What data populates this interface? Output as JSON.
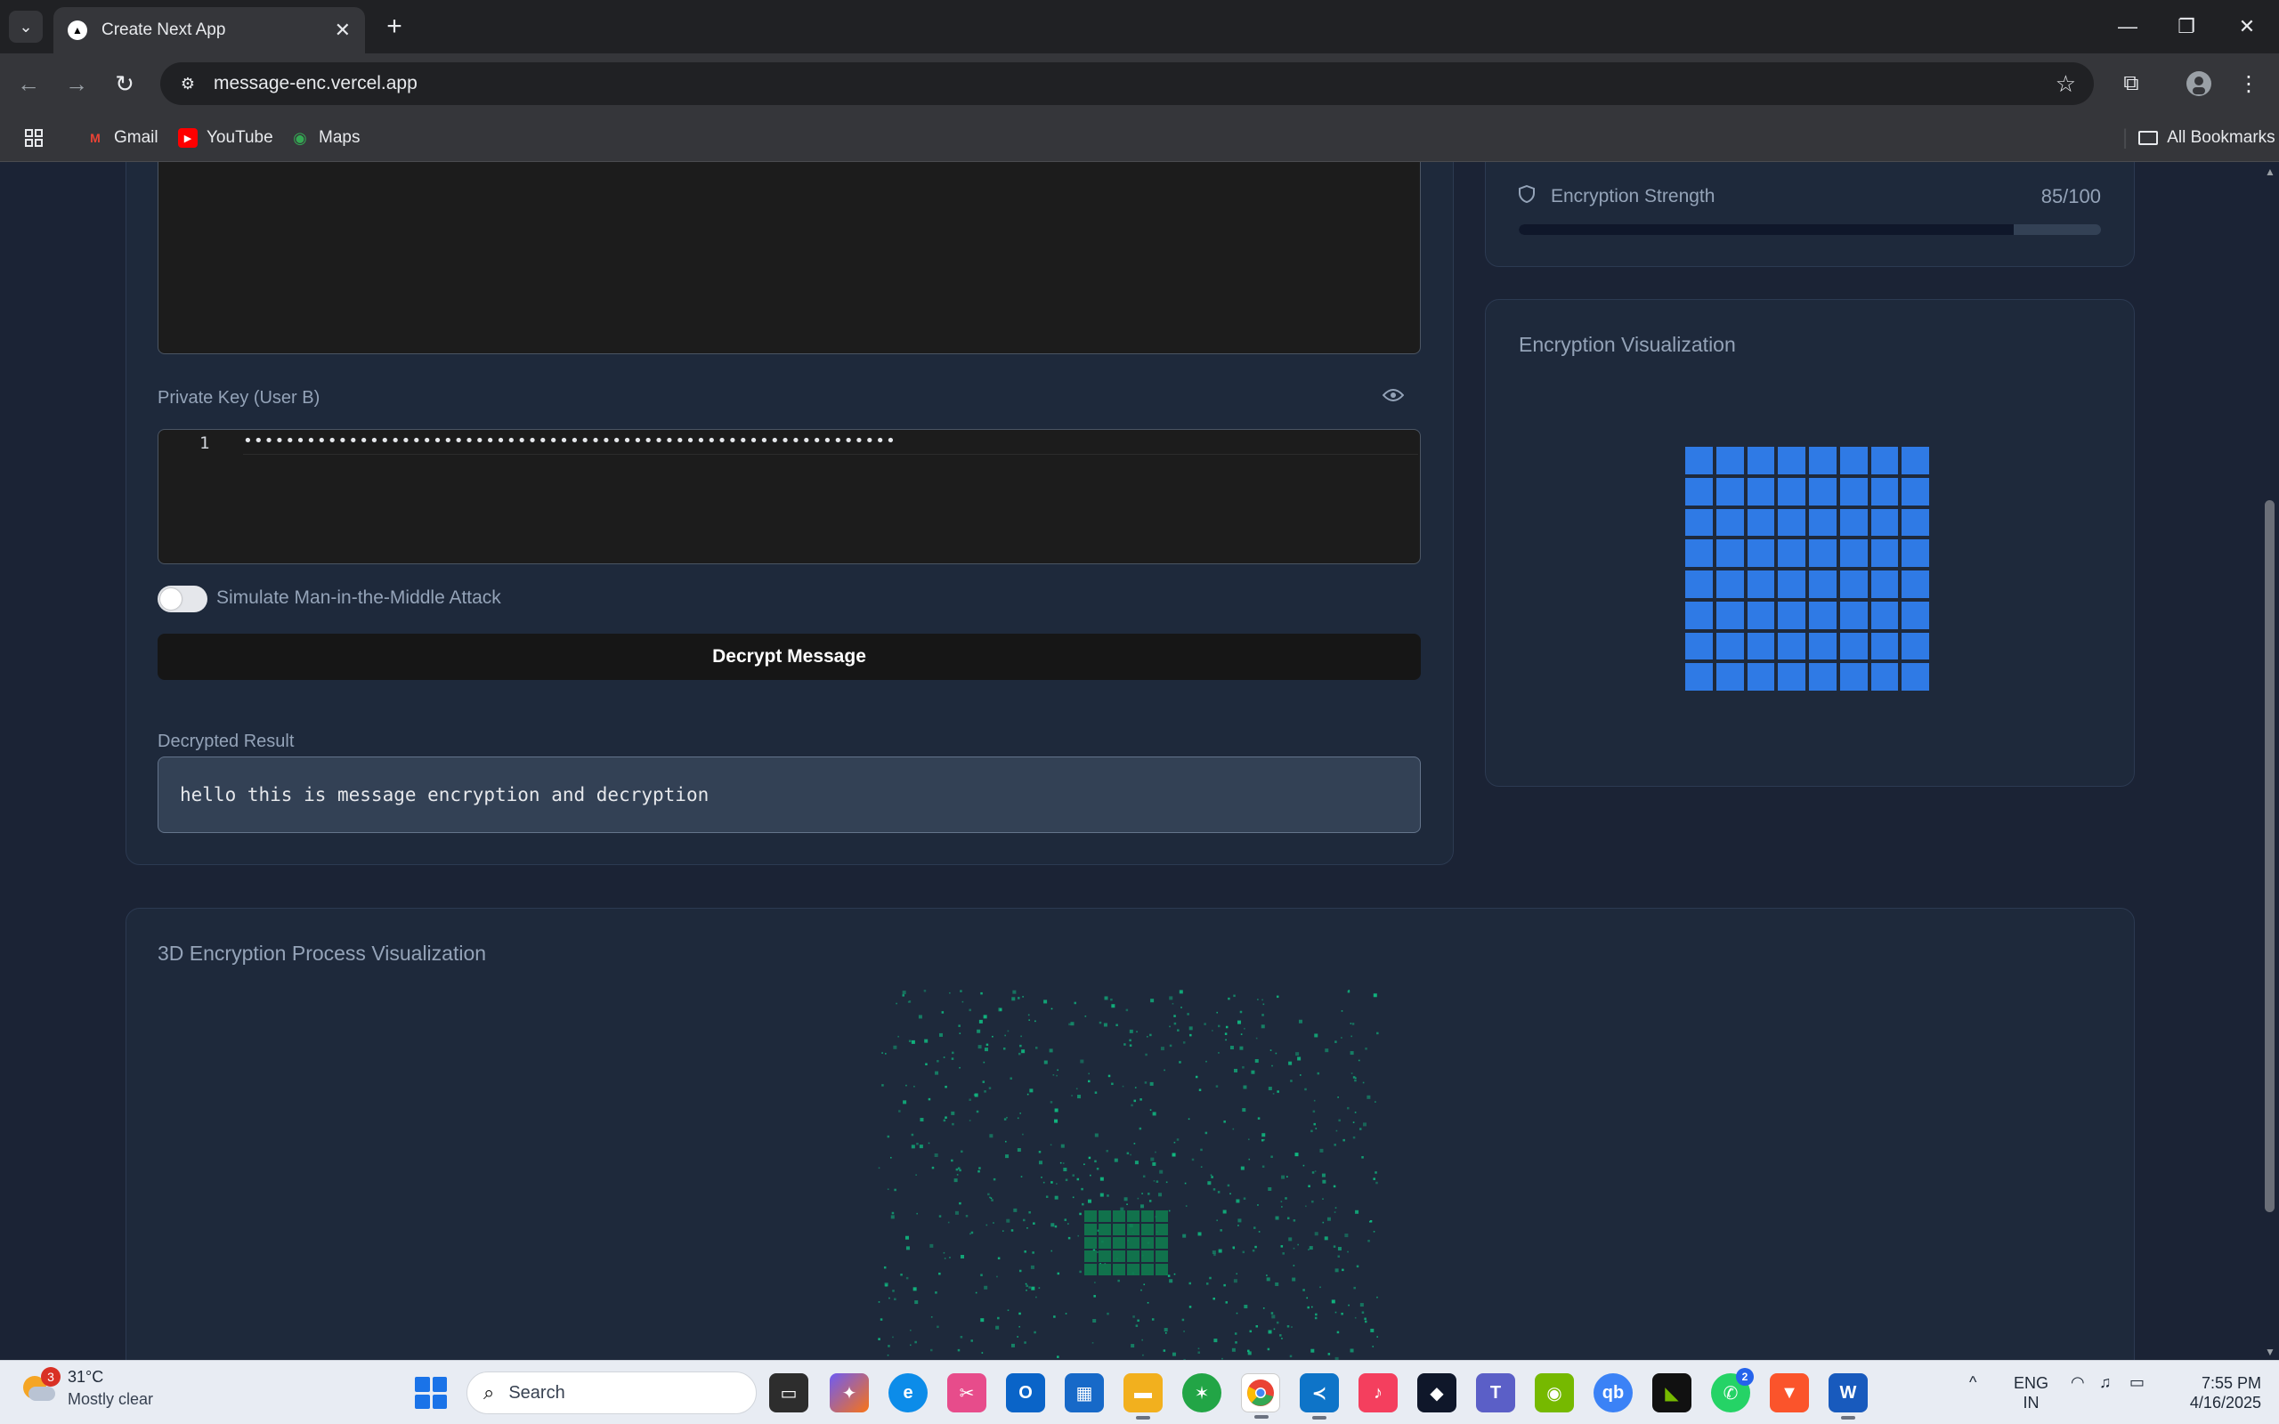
{
  "browser": {
    "tab_title": "Create Next App",
    "url": "message-enc.vercel.app",
    "bookmarks": [
      {
        "label": "Gmail",
        "icon": "gmail-icon"
      },
      {
        "label": "YouTube",
        "icon": "youtube-icon"
      },
      {
        "label": "Maps",
        "icon": "maps-icon"
      }
    ],
    "all_bookmarks": "All Bookmarks"
  },
  "decrypt": {
    "private_key_label": "Private Key (User B)",
    "key_line_number": "1",
    "key_masked": "••••••••••••••••••••••••••••••••••••••••••••••••••••••••••••••",
    "mitm_label": "Simulate Man-in-the-Middle Attack",
    "mitm_enabled": false,
    "decrypt_button": "Decrypt Message",
    "result_label": "Decrypted Result",
    "result_text": "hello this is message encryption and decryption"
  },
  "strength": {
    "label": "Encryption Strength",
    "value_text": "85/100",
    "value": 85,
    "max": 100
  },
  "visualization": {
    "title": "Encryption Visualization",
    "grid_rows": 8,
    "grid_cols": 8,
    "cell_color": "#2f7ae5"
  },
  "process3d": {
    "title": "3D Encryption Process Visualization",
    "particle_color": "#10b981"
  },
  "taskbar": {
    "weather_badge": "3",
    "temperature": "31°C",
    "condition": "Mostly clear",
    "search_placeholder": "Search",
    "whatsapp_badge": "2",
    "lang_line1": "ENG",
    "lang_line2": "IN",
    "time": "7:55 PM",
    "date": "4/16/2025"
  }
}
